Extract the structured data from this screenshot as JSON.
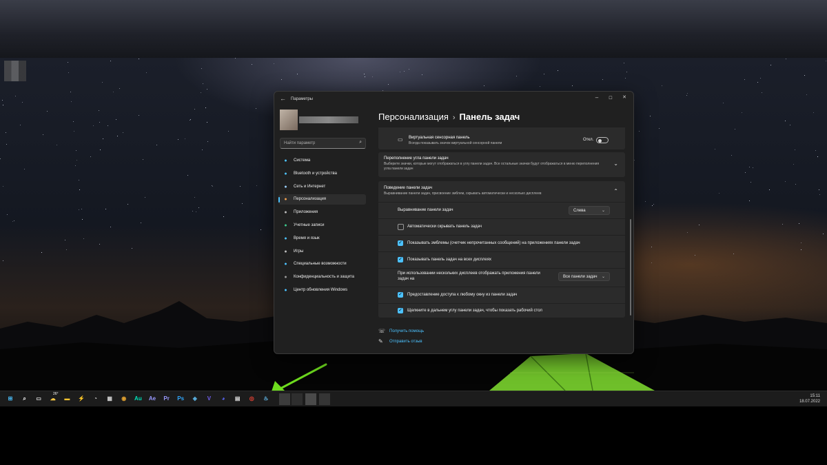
{
  "window": {
    "title": "Параметры",
    "breadcrumb_parent": "Персонализация",
    "breadcrumb_sep": "›",
    "breadcrumb_current": "Панель задач",
    "controls": {
      "minimize": "–",
      "maximize": "☐",
      "close": "✕"
    }
  },
  "sidebar": {
    "search_placeholder": "Найти параметр",
    "items": [
      {
        "label": "Система",
        "icon": "monitor-icon",
        "color": "#4cc2ff"
      },
      {
        "label": "Bluetooth и устройства",
        "icon": "bluetooth-icon",
        "color": "#4cc2ff"
      },
      {
        "label": "Сеть и Интернет",
        "icon": "wifi-icon",
        "color": "#9ad0ff"
      },
      {
        "label": "Персонализация",
        "icon": "brush-icon",
        "color": "#f0a050",
        "active": true
      },
      {
        "label": "Приложения",
        "icon": "apps-icon",
        "color": "#bcbcbc"
      },
      {
        "label": "Учетные записи",
        "icon": "person-icon",
        "color": "#3dc98c"
      },
      {
        "label": "Время и язык",
        "icon": "globe-clock-icon",
        "color": "#4cc2ff"
      },
      {
        "label": "Игры",
        "icon": "gamepad-icon",
        "color": "#bcbcbc"
      },
      {
        "label": "Специальные возможности",
        "icon": "accessibility-icon",
        "color": "#4cc2ff"
      },
      {
        "label": "Конфиденциальность и защита",
        "icon": "shield-icon",
        "color": "#9a9a9a"
      },
      {
        "label": "Центр обновления Windows",
        "icon": "update-icon",
        "color": "#4cc2ff"
      }
    ]
  },
  "content": {
    "touchpad": {
      "title": "Виртуальная сенсорная панель",
      "desc": "Всегда показывать значок виртуальной сенсорной панели",
      "toggle_label": "Откл.",
      "toggle_on": false
    },
    "overflow": {
      "title": "Переполнение угла панели задач",
      "desc": "Выберите значки, которые могут отображаться в углу панели задач. Все остальные значки будут отображаться в меню переполнения угла панели задач"
    },
    "behavior": {
      "title": "Поведение панели задач",
      "desc": "Выравнивание панели задач, присвоение эмблем, скрывать автоматически и несколько дисплеев",
      "alignment_label": "Выравнивание панели задач",
      "alignment_value": "Слева",
      "autohide_label": "Автоматически скрывать панель задач",
      "autohide_checked": false,
      "badges_label": "Показывать эмблемы (счетчик непрочитанных сообщений) на приложениях панели задач",
      "badges_checked": true,
      "all_displays_label": "Показывать панель задач на всех дисплеях",
      "all_displays_checked": true,
      "multi_display_label": "При использовании нескольких дисплеев отображать приложения панели задач на",
      "multi_display_value": "Все панели задач",
      "share_label": "Предоставление доступа к любому окну из панели задач",
      "share_checked": true,
      "corner_label": "Щелкните в дальнем углу панели задач, чтобы показать рабочий стол",
      "corner_checked": true
    },
    "help_link": "Получить помощь",
    "feedback_link": "Отправить отзыв"
  },
  "taskbar": {
    "weather_temp": "26°",
    "time": "15:11",
    "date": "18.07.2022",
    "apps": [
      {
        "icon": "windows-start-icon",
        "glyph": "⊞",
        "color": "#4cc2ff"
      },
      {
        "icon": "search-icon",
        "glyph": "⌕",
        "color": "#ffffff"
      },
      {
        "icon": "task-view-icon",
        "glyph": "▭",
        "color": "#dddddd"
      },
      {
        "icon": "weather-icon",
        "glyph": "☁",
        "color": "#f5c542"
      },
      {
        "icon": "file-explorer-icon",
        "glyph": "▬",
        "color": "#f2c230"
      },
      {
        "icon": "lightning-icon",
        "glyph": "⚡",
        "color": "#ffd23a"
      },
      {
        "icon": "clock-icon",
        "glyph": "◔",
        "color": "#dddddd"
      },
      {
        "icon": "calculator-icon",
        "glyph": "▦",
        "color": "#cccccc"
      },
      {
        "icon": "davinci-icon",
        "glyph": "◉",
        "color": "#e0a030"
      },
      {
        "icon": "audition-icon",
        "glyph": "Au",
        "color": "#00e4bb"
      },
      {
        "icon": "after-effects-icon",
        "glyph": "Ae",
        "color": "#9999ff"
      },
      {
        "icon": "premiere-icon",
        "glyph": "Pr",
        "color": "#9999ff"
      },
      {
        "icon": "photoshop-icon",
        "glyph": "Ps",
        "color": "#31a8ff"
      },
      {
        "icon": "network-icon",
        "glyph": "◈",
        "color": "#5ab0e0"
      },
      {
        "icon": "viber-icon",
        "glyph": "V",
        "color": "#7360f2"
      },
      {
        "icon": "discord-icon",
        "glyph": "◕",
        "color": "#5865f2"
      },
      {
        "icon": "document-icon",
        "glyph": "▤",
        "color": "#dddddd"
      },
      {
        "icon": "chrome-icon",
        "glyph": "◎",
        "color": "#ea4335"
      },
      {
        "icon": "steam-icon",
        "glyph": "♨",
        "color": "#66c0f4"
      }
    ]
  }
}
